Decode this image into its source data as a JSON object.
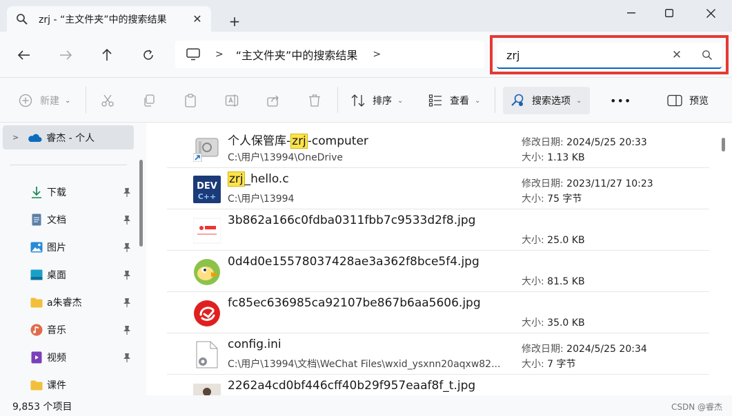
{
  "window": {
    "tab_title": "zrj - “主文件夹”中的搜索结果",
    "new_tab_symbol": "+",
    "tab_icon": "search-icon",
    "controls": [
      "minimize-icon",
      "maximize-icon",
      "close-icon"
    ]
  },
  "nav": {
    "breadcrumb_separator": ">",
    "breadcrumb": "“主文件夹”中的搜索结果",
    "breadcrumb_more": ">"
  },
  "search": {
    "value": "zrj",
    "clear_symbol": "✕",
    "highlight_color": "#e53935",
    "accent": "#0067c0"
  },
  "commands": {
    "new_label": "新建",
    "sort_label": "排序",
    "view_label": "查看",
    "search_options_label": "搜索选项",
    "more_label": "•••",
    "preview_label": "预览"
  },
  "sidebar": {
    "top_label": "睿杰 - 个人",
    "items": [
      {
        "label": "下载",
        "icon": "download-icon"
      },
      {
        "label": "文档",
        "icon": "document-icon"
      },
      {
        "label": "图片",
        "icon": "pictures-icon"
      },
      {
        "label": "桌面",
        "icon": "desktop-icon"
      },
      {
        "label": "a朱睿杰",
        "icon": "folder-icon"
      },
      {
        "label": "音乐",
        "icon": "music-icon"
      },
      {
        "label": "视频",
        "icon": "video-icon"
      },
      {
        "label": "课件",
        "icon": "folder-icon"
      }
    ]
  },
  "results": [
    {
      "name_pre": "个人保管库-",
      "name_hl": "zrj",
      "name_post": "-computer",
      "path": "C:\\用户\\13994\\OneDrive",
      "date_label": "修改日期:",
      "date": "2024/5/25 20:33",
      "size_label": "大小:",
      "size": "1.13 KB",
      "icon": "vault-shortcut-icon"
    },
    {
      "name_pre": "",
      "name_hl": "zrj",
      "name_post": "_hello.c",
      "path": "C:\\用户\\13994",
      "date_label": "修改日期:",
      "date": "2023/11/27 10:23",
      "size_label": "大小:",
      "size": "75 字节",
      "icon": "devcpp-icon"
    },
    {
      "name_pre": "3b862a166c0fdba0311fbb7c9533d2f8.jpg",
      "name_hl": "",
      "name_post": "",
      "path": "",
      "date_label": "",
      "date": "",
      "size_label": "大小:",
      "size": "25.0 KB",
      "icon": "jd-thumbnail"
    },
    {
      "name_pre": "0d4d0e15578037428ae3a362f8bce5f4.jpg",
      "name_hl": "",
      "name_post": "",
      "path": "",
      "date_label": "",
      "date": "",
      "size_label": "大小:",
      "size": "81.5 KB",
      "icon": "bird-thumbnail"
    },
    {
      "name_pre": "fc85ec636985ca92107be867b6aa5606.jpg",
      "name_hl": "",
      "name_post": "",
      "path": "",
      "date_label": "",
      "date": "",
      "size_label": "大小:",
      "size": "35.0 KB",
      "icon": "red-logo-thumbnail"
    },
    {
      "name_pre": "config.ini",
      "name_hl": "",
      "name_post": "",
      "path": "C:\\用户\\13994\\文档\\WeChat Files\\wxid_ysxnn20aqxw82...",
      "date_label": "修改日期:",
      "date": "2024/5/25 20:34",
      "size_label": "大小:",
      "size": "7 字节",
      "icon": "ini-file-icon"
    },
    {
      "name_pre": "2262a4cd0bf446cff40b29f957eaaf8f_t.jpg",
      "name_hl": "",
      "name_post": "",
      "path": "",
      "date_label": "",
      "date": "",
      "size_label": "",
      "size": "",
      "icon": "photo-thumbnail"
    }
  ],
  "status": {
    "count": "9,853 个项目",
    "watermark": "CSDN @睿杰"
  }
}
